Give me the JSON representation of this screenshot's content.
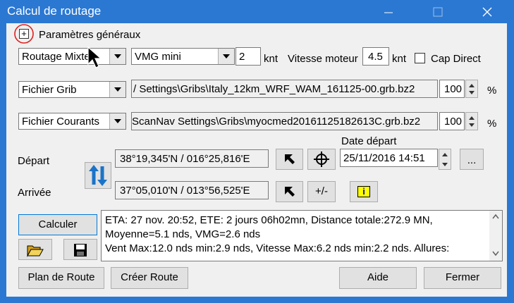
{
  "window": {
    "title": "Calcul de routage",
    "minimize_icon": "minimize-icon",
    "maximize_icon": "maximize-icon",
    "close_icon": "close-icon"
  },
  "general": {
    "expand_symbol": "+",
    "label": "Paramètres généraux"
  },
  "routing": {
    "mode_value": "Routage Mixte",
    "vmg_value": "VMG mini",
    "vmg_speed": "2",
    "vmg_unit": "knt",
    "motor_label": "Vitesse moteur",
    "motor_speed": "4.5",
    "motor_unit": "knt",
    "cap_direct_label": "Cap Direct"
  },
  "grib": {
    "type_value": "Fichier Grib",
    "path": "/ Settings\\Gribs\\Italy_12km_WRF_WAM_161125-00.grb.bz2",
    "percent": "100",
    "percent_unit": "%"
  },
  "currents": {
    "type_value": "Fichier Courants",
    "path": "ScanNav Settings\\Gribs\\myocmed20161125182613C.grb.bz2",
    "percent": "100",
    "percent_unit": "%"
  },
  "departure": {
    "label": "Départ",
    "position": "38°19,345'N / 016°25,816'E",
    "date_label": "Date départ",
    "date_value": "25/11/2016 14:51",
    "more_label": "..."
  },
  "arrival": {
    "label": "Arrivée",
    "position": "37°05,010'N / 013°56,525'E",
    "plusminus_label": "+/-"
  },
  "actions": {
    "calculate_label": "Calculer"
  },
  "results": {
    "lines": [
      "ETA: 27 nov. 20:52, ETE: 2 jours 06h02mn, Distance totale:272.9 MN,",
      "Moyenne=5.1 nds, VMG=2.6 nds",
      "Vent Max:12.0 nds min:2.9 nds, Vitesse Max:6.2 nds min:2.2 nds. Allures:"
    ]
  },
  "footer": {
    "plan_label": "Plan de Route",
    "create_label": "Créer Route",
    "help_label": "Aide",
    "close_label": "Fermer"
  },
  "colors": {
    "titlebar": "#2b78d3",
    "swap_arrow": "#1a73c8",
    "info_yellow": "#ffff00",
    "highlight_circle": "#e02020"
  }
}
